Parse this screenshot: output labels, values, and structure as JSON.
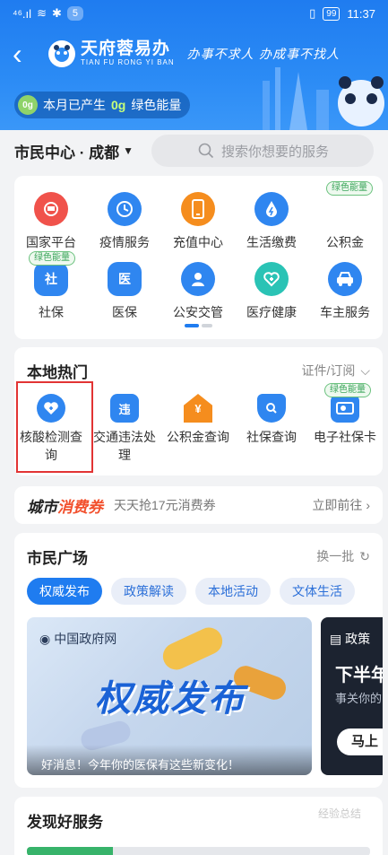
{
  "status_bar": {
    "signal": "⁴⁶.ıl",
    "notif_count": "5",
    "battery": "99",
    "time": "11:37"
  },
  "header": {
    "app_name": "天府蓉易办",
    "app_pinyin": "TIAN FU RONG YI BAN",
    "slogan": "办事不求人 办成事不找人",
    "energy_prefix": "本月已产生",
    "energy_value": "0g",
    "energy_suffix": "绿色能量"
  },
  "location": {
    "label": "市民中心 · 成都"
  },
  "search": {
    "placeholder": "搜索你想要的服务"
  },
  "services": {
    "row1": [
      {
        "label": "国家平台",
        "icon": "national-icon",
        "color": "#f0524b"
      },
      {
        "label": "疫情服务",
        "icon": "clock-icon",
        "color": "#2f86f0"
      },
      {
        "label": "充值中心",
        "icon": "phone-icon",
        "color": "#f58d1e"
      },
      {
        "label": "生活缴费",
        "icon": "drop-icon",
        "color": "#2f86f0"
      },
      {
        "label": "公积金",
        "icon": "fund-icon",
        "color": "#ffffff",
        "badge": "绿色能量"
      }
    ],
    "row2": [
      {
        "label": "社保",
        "icon": "shebao-icon",
        "color": "#2f86f0",
        "badge": "绿色能量",
        "glyph": "社"
      },
      {
        "label": "医保",
        "icon": "yibao-icon",
        "color": "#2f86f0",
        "glyph": "医"
      },
      {
        "label": "公安交管",
        "icon": "police-icon",
        "color": "#2f86f0"
      },
      {
        "label": "医疗健康",
        "icon": "health-icon",
        "color": "#2ac3b5"
      },
      {
        "label": "车主服务",
        "icon": "car-icon",
        "color": "#2f86f0"
      }
    ]
  },
  "hot": {
    "title": "本地热门",
    "link": "证件/订阅",
    "items": [
      {
        "label": "核酸检测查询",
        "icon": "heart-shield-icon",
        "color": "#2f86f0"
      },
      {
        "label": "交通违法处理",
        "icon": "violation-icon",
        "color": "#2f86f0",
        "glyph": "违"
      },
      {
        "label": "公积金查询",
        "icon": "house-yuan-icon",
        "color": "#f58d1e",
        "glyph": "¥"
      },
      {
        "label": "社保查询",
        "icon": "search-shield-icon",
        "color": "#2f86f0"
      },
      {
        "label": "电子社保卡",
        "icon": "card-icon",
        "color": "#2f86f0",
        "badge": "绿色能量"
      }
    ]
  },
  "coupon": {
    "logo_a": "城市",
    "logo_b": "消费券",
    "desc": "天天抢17元消费券",
    "go": "立即前往"
  },
  "plaza": {
    "title": "市民广场",
    "refresh": "换一批",
    "tabs": [
      "权威发布",
      "政策解读",
      "本地活动",
      "文体生活"
    ],
    "banner": {
      "source": "中国政府网",
      "headline": "权威发布",
      "caption": "好消息！今年你的医保有这些新变化！"
    },
    "banner2": {
      "tag": "政策",
      "title": "下半年",
      "sub": "事关你的",
      "button": "马上"
    }
  },
  "discover": {
    "title": "发现好服务",
    "watermark": "经验总结",
    "progress": 0.25
  }
}
